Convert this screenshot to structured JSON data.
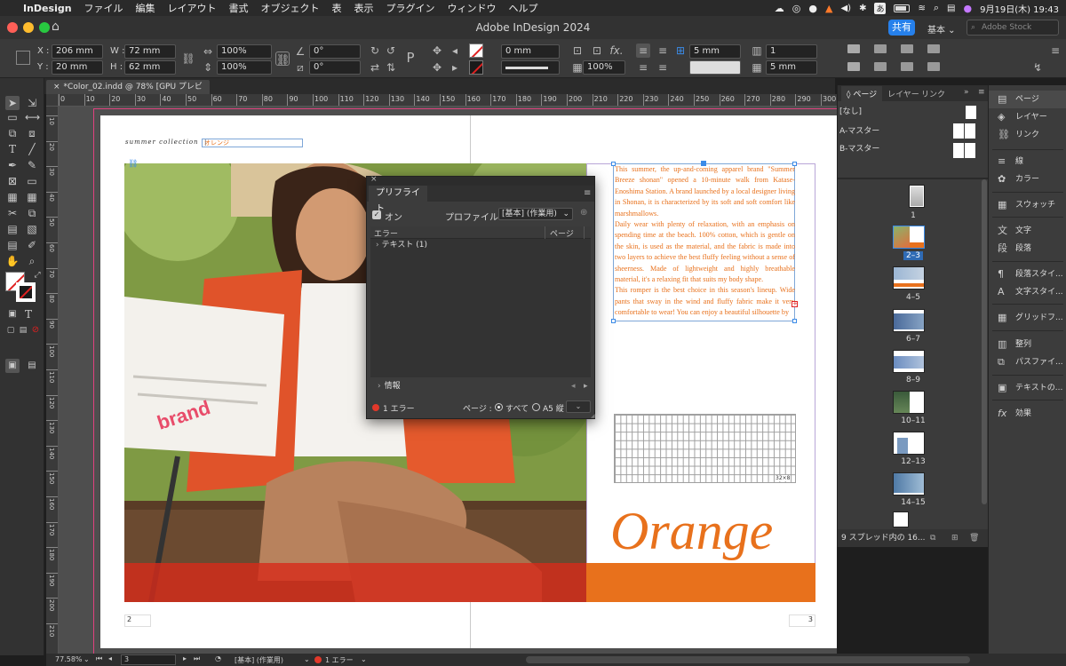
{
  "menubar": {
    "app": "InDesign",
    "items": [
      "ファイル",
      "編集",
      "レイアウト",
      "書式",
      "オブジェクト",
      "表",
      "表示",
      "プラグイン",
      "ウィンドウ",
      "ヘルプ"
    ],
    "status": {
      "date_time": "9月19日(木) 19:43",
      "input_method": "あ"
    }
  },
  "titlebar": {
    "title": "Adobe InDesign 2024",
    "share_label": "共有",
    "workspace_label": "基本",
    "stock_placeholder": "Adobe Stock"
  },
  "control": {
    "x_label": "X :",
    "x_value": "206 mm",
    "y_label": "Y :",
    "y_value": "20 mm",
    "w_label": "W :",
    "w_value": "72 mm",
    "h_label": "H :",
    "h_value": "62 mm",
    "scale_x": "100%",
    "scale_y": "100%",
    "rotate": "0°",
    "shear": "0°",
    "stroke_weight": "0 mm",
    "opacity": "100%",
    "gutter": "5 mm",
    "columns": "1",
    "col_gutter": "5 mm"
  },
  "document": {
    "tab_title": "*Color_02.indd @ 78% [GPU プレビュー]"
  },
  "ruler": {
    "h_ticks": [
      "0",
      "10",
      "20",
      "30",
      "40",
      "50",
      "60",
      "70",
      "80",
      "90",
      "100",
      "110",
      "120",
      "130",
      "140",
      "150",
      "160",
      "170",
      "180",
      "190",
      "200",
      "210",
      "220",
      "230",
      "240",
      "250",
      "260",
      "270",
      "280",
      "290",
      "300"
    ],
    "v_ticks": [
      "10",
      "20",
      "30",
      "40",
      "50",
      "60",
      "70",
      "80",
      "90",
      "100",
      "110",
      "120",
      "130",
      "140",
      "150",
      "160",
      "170",
      "180",
      "190",
      "200",
      "210"
    ]
  },
  "spread": {
    "running_head": "summer collection",
    "running_head_sep": "|",
    "running_head_color_word": "オレンジ",
    "body_text": "This summer, the up-and-coming apparel brand \"Summer Breeze shonan\" opened a 10-minute walk from Katase-Enoshima Station. A brand launched by a local designer living in Shonan, it is characterized by its soft and soft comfort like marshmallows.\nDaily wear with plenty of relaxation, with an emphasis on spending time at the beach. 100% cotton, which is gentle on the skin, is used as the material, and the fabric is made into two layers to achieve the best fluffy feeling without a sense of sheerness. Made of lightweight and highly breathable material, it's a relaxing fit that suits my body shape.\nThis romper is the best choice in this season's lineup. Wide pants that sway in the wind and fluffy fabric make it very comfortable to wear! You can enjoy a beautiful silhouette by",
    "grid_label": "32×8",
    "headline": "Orange",
    "page_left": "2",
    "page_right": "3",
    "accent_color": "#e8711c"
  },
  "preflight": {
    "title": "プリフライト",
    "on_label": "オン",
    "profile_label": "プロファイル :",
    "profile_value": "[基本] (作業用)",
    "col_error": "エラー",
    "col_page": "ページ",
    "error_item": "テキスト (1)",
    "info_label": "情報",
    "error_count": "1 エラー",
    "pages_label": "ページ :",
    "all_label": "すべて",
    "range_value": "A5 縦"
  },
  "pages_panel": {
    "tabs": [
      "ページ",
      "レイヤー",
      "リンク"
    ],
    "masters": [
      "[なし]",
      "A-マスター",
      "B-マスター"
    ],
    "pages": [
      "1",
      "2–3",
      "4–5",
      "6–7",
      "8–9",
      "10–11",
      "12–13",
      "14–15"
    ],
    "footer": "9 スプレッド内の 16..."
  },
  "side_panel": {
    "items": [
      "ページ",
      "レイヤー",
      "リンク",
      "線",
      "カラー",
      "スウォッチ",
      "文字",
      "段落",
      "段落スタイ...",
      "文字スタイ...",
      "グリッドフ...",
      "整列",
      "パスファイ...",
      "テキストの...",
      "効果"
    ]
  },
  "status": {
    "zoom": "77.58%",
    "page": "3",
    "profile": "[基本] (作業用)",
    "errors": "1 エラー"
  }
}
